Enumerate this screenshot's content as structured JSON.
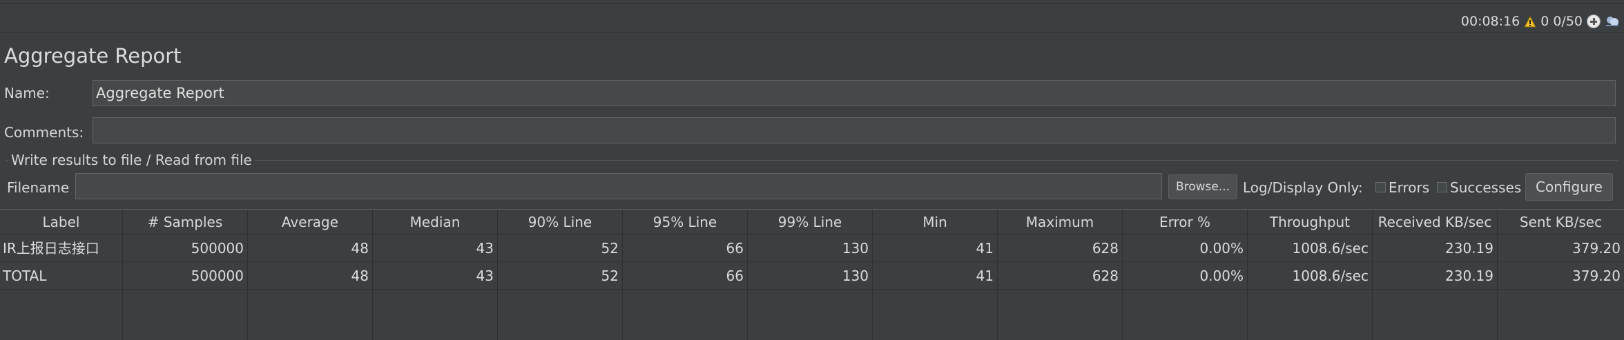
{
  "status": {
    "elapsed": "00:08:16",
    "warnings": "0",
    "threads": "0/50"
  },
  "colors": {
    "warning": "#f2c12e",
    "background": "#3c3f41",
    "field": "#45494a"
  },
  "panel": {
    "title": "Aggregate Report",
    "name_label": "Name:",
    "name_value": "Aggregate Report",
    "comments_label": "Comments:",
    "comments_value": "",
    "file_group_title": "Write results to file / Read from file",
    "filename_label": "Filename",
    "filename_value": "",
    "browse_label": "Browse...",
    "log_display_label": "Log/Display Only:",
    "errors_label": "Errors",
    "successes_label": "Successes",
    "configure_label": "Configure"
  },
  "table": {
    "columns": [
      "Label",
      "# Samples",
      "Average",
      "Median",
      "90% Line",
      "95% Line",
      "99% Line",
      "Min",
      "Maximum",
      "Error %",
      "Throughput",
      "Received KB/sec",
      "Sent KB/sec"
    ],
    "rows": [
      [
        "IR上报日志接口",
        "500000",
        "48",
        "43",
        "52",
        "66",
        "130",
        "41",
        "628",
        "0.00%",
        "1008.6/sec",
        "230.19",
        "379.20"
      ],
      [
        "TOTAL",
        "500000",
        "48",
        "43",
        "52",
        "66",
        "130",
        "41",
        "628",
        "0.00%",
        "1008.6/sec",
        "230.19",
        "379.20"
      ]
    ]
  }
}
